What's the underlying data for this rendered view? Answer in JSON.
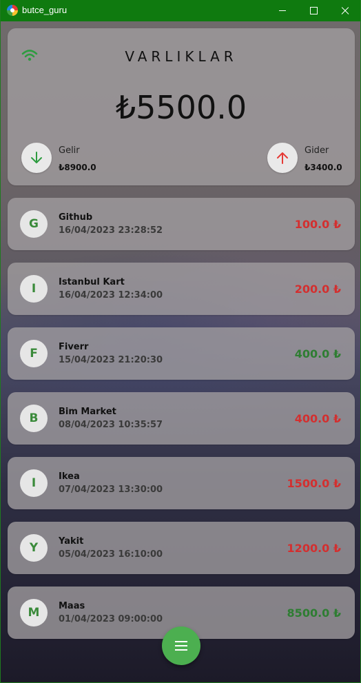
{
  "window": {
    "title": "butce_guru"
  },
  "summary": {
    "heading": "VARLIKLAR",
    "balance": "₺5500.0",
    "income": {
      "label": "Gelir",
      "value": "₺8900.0",
      "icon": "arrow-down-icon"
    },
    "expense": {
      "label": "Gider",
      "value": "₺3400.0",
      "icon": "arrow-up-icon"
    },
    "status_icon": "wifi-icon"
  },
  "transactions": [
    {
      "initial": "G",
      "name": "Github",
      "date": "16/04/2023 23:28:52",
      "amount": "100.0 ₺",
      "type": "expense"
    },
    {
      "initial": "I",
      "name": "Istanbul Kart",
      "date": "16/04/2023 12:34:00",
      "amount": "200.0 ₺",
      "type": "expense"
    },
    {
      "initial": "F",
      "name": "Fiverr",
      "date": "15/04/2023 21:20:30",
      "amount": "400.0 ₺",
      "type": "income"
    },
    {
      "initial": "B",
      "name": "Bim Market",
      "date": "08/04/2023 10:35:57",
      "amount": "400.0 ₺",
      "type": "expense"
    },
    {
      "initial": "I",
      "name": "Ikea",
      "date": "07/04/2023 13:30:00",
      "amount": "1500.0 ₺",
      "type": "expense"
    },
    {
      "initial": "Y",
      "name": "Yakit",
      "date": "05/04/2023 16:10:00",
      "amount": "1200.0 ₺",
      "type": "expense"
    },
    {
      "initial": "M",
      "name": "Maas",
      "date": "01/04/2023 09:00:00",
      "amount": "8500.0 ₺",
      "type": "income"
    }
  ],
  "fab": {
    "icon": "menu-icon"
  },
  "colors": {
    "titlebar": "#0f7a0f",
    "accent": "#4caf50",
    "expense": "#d32f2f",
    "income": "#2e7d32"
  }
}
